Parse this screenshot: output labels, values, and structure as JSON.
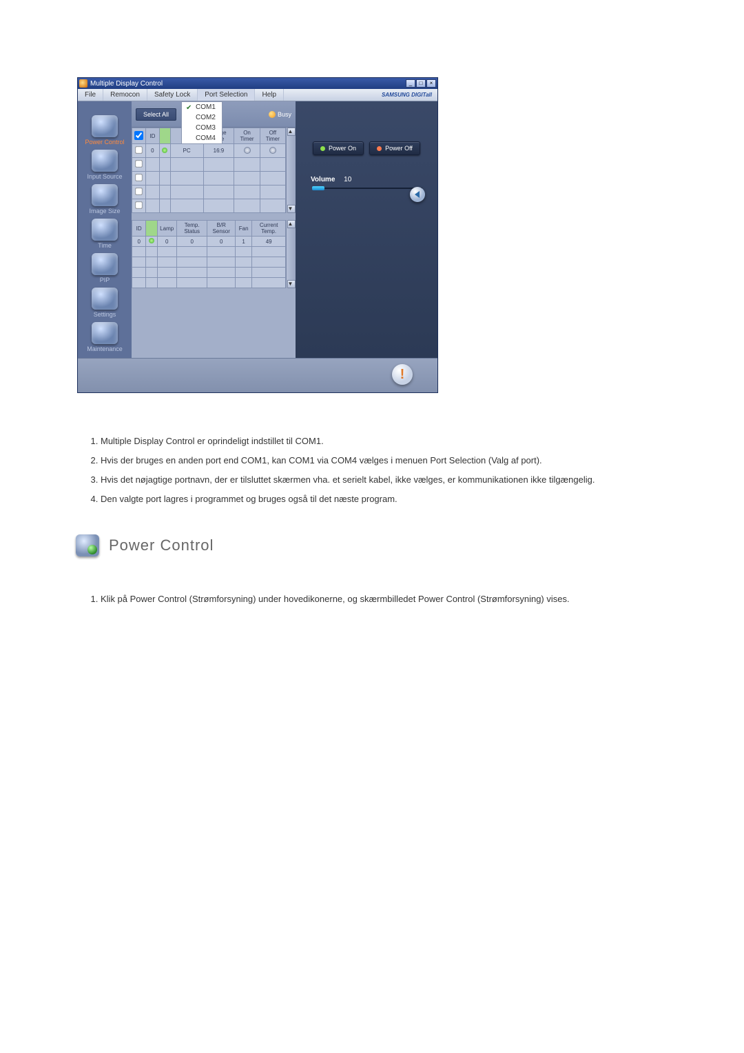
{
  "app": {
    "title": "Multiple Display Control",
    "brand": "SAMSUNG DIGITall"
  },
  "menu": {
    "file": "File",
    "remocon": "Remocon",
    "safety_lock": "Safety Lock",
    "port_selection": "Port Selection",
    "help": "Help"
  },
  "win_btns": {
    "min": "_",
    "max": "□",
    "close": "×"
  },
  "ports": {
    "com1": "COM1",
    "com2": "COM2",
    "com3": "COM3",
    "com4": "COM4"
  },
  "nav": {
    "power_control": "Power Control",
    "input_source": "Input Source",
    "image_size": "Image Size",
    "time": "Time",
    "pip": "PIP",
    "settings": "Settings",
    "maintenance": "Maintenance"
  },
  "top_controls": {
    "select_all": "Select All",
    "busy": "Busy"
  },
  "grid1": {
    "headers": {
      "chk": "",
      "id": "ID",
      "status": "",
      "source": "",
      "image_size": "Image Size",
      "on_timer": "On Timer",
      "off_timer": "Off Timer"
    },
    "row": {
      "id": "0",
      "source": "PC",
      "image_size": "16:9",
      "on_timer": "",
      "off_timer": ""
    }
  },
  "grid2": {
    "headers": {
      "id": "ID",
      "status": "",
      "lamp": "Lamp",
      "temp_status": "Temp. Status",
      "br_sensor": "B/R Sensor",
      "fan": "Fan",
      "current_temp": "Current Temp."
    },
    "row": {
      "id": "0",
      "lamp": "0",
      "temp_status": "0",
      "br_sensor": "0",
      "fan": "1",
      "current_temp": "49"
    }
  },
  "right": {
    "power_on": "Power On",
    "power_off": "Power Off",
    "volume_label": "Volume",
    "volume_value": "10"
  },
  "alert": "!",
  "doc_list1": {
    "i1": "Multiple Display Control er oprindeligt indstillet til COM1.",
    "i2": "Hvis der bruges en anden port end COM1, kan COM1 via COM4 vælges i menuen Port Selection (Valg af port).",
    "i3": "Hvis det nøjagtige portnavn, der er tilsluttet skærmen vha. et serielt kabel, ikke vælges, er kommunikationen ikke tilgængelig.",
    "i4": "Den valgte port lagres i programmet og bruges også til det næste program."
  },
  "heading": "Power Control",
  "doc_list2": {
    "i1": "Klik på Power Control (Strømforsyning) under hovedikonerne, og skærmbilledet Power Control (Strømforsyning) vises."
  }
}
